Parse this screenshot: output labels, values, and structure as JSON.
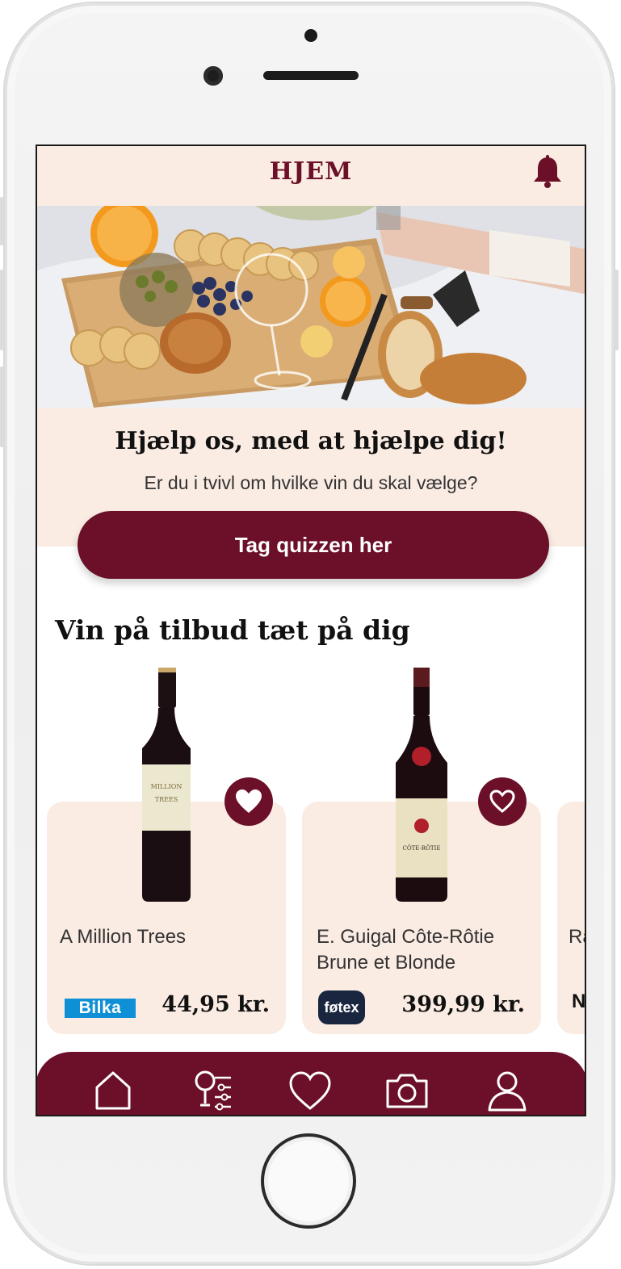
{
  "header": {
    "title": "HJEM",
    "bell_icon": "bell-icon"
  },
  "promo": {
    "heading": "Hjælp os, med at hjælpe dig!",
    "subheading": "Er du i tvivl om hvilke vin du skal vælge?",
    "button_label": "Tag quizzen her"
  },
  "offers": {
    "heading": "Vin på tilbud tæt på dig",
    "items": [
      {
        "name": "A Million Trees",
        "store": "Bilka",
        "price": "44,95 kr.",
        "bottle_label": "A MILLION TREES"
      },
      {
        "name": "E. Guigal Côte-Rôtie Brune et Blonde",
        "store": "føtex",
        "price": "399,99 kr.",
        "bottle_label": "CÔTE-RÔTIE"
      },
      {
        "name": "Ra",
        "store": "N"
      }
    ]
  },
  "nav": {
    "items": [
      "home-icon",
      "wine-filter-icon",
      "heart-icon",
      "camera-icon",
      "profile-icon"
    ]
  },
  "colors": {
    "brand": "#6b1028",
    "cream": "#faece3",
    "bilka": "#0f8fd6",
    "fotex": "#1a2540"
  }
}
